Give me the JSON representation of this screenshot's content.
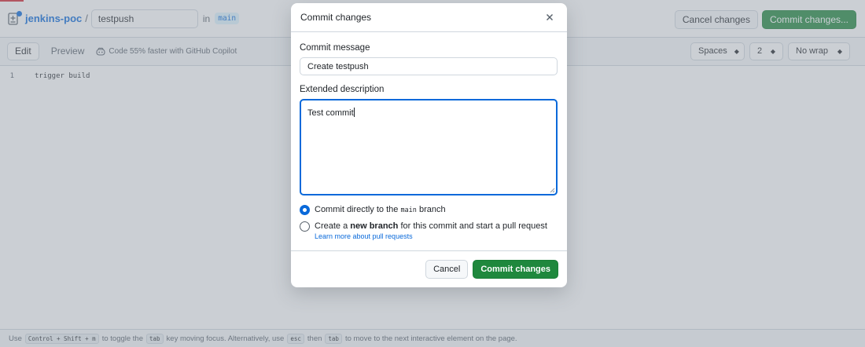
{
  "colors": {
    "accent": "#0969da",
    "primary_green": "#1f883d",
    "overlay": "#8c959f"
  },
  "header": {
    "repo_name": "jenkins-poc",
    "separator": "/",
    "filename": "testpush",
    "in_label": "in",
    "branch": "main",
    "cancel_label": "Cancel changes",
    "commit_label": "Commit changes...",
    "file_icon": "file-diff-icon"
  },
  "toolbar": {
    "edit_tab": "Edit",
    "preview_tab": "Preview",
    "copilot_icon": "copilot-icon",
    "copilot_text": "Code 55% faster with GitHub Copilot",
    "indent_mode": "Spaces",
    "indent_size": "2",
    "wrap_mode": "No wrap"
  },
  "editor": {
    "lines": [
      {
        "number": "1",
        "text": "trigger build"
      }
    ]
  },
  "footer": {
    "text_1": "Use",
    "key_1": "Control + Shift + m",
    "text_2": "to toggle the",
    "key_2": "tab",
    "text_3": "key moving focus. Alternatively, use",
    "key_3": "esc",
    "text_4": "then",
    "key_4": "tab",
    "text_5": "to move to the next interactive element on the page."
  },
  "dialog": {
    "title": "Commit changes",
    "close_icon": "close-icon",
    "message_label": "Commit message",
    "message_value": "Create testpush",
    "description_label": "Extended description",
    "description_value": "Test commit",
    "option_direct": {
      "prefix": "Commit directly to the",
      "branch": "main",
      "suffix": "branch",
      "checked": true
    },
    "option_new_branch": {
      "prefix": "Create a",
      "bold": "new branch",
      "suffix": "for this commit and start a pull request",
      "checked": false
    },
    "learn_more": "Learn more about pull requests",
    "cancel_label": "Cancel",
    "commit_label": "Commit changes"
  }
}
